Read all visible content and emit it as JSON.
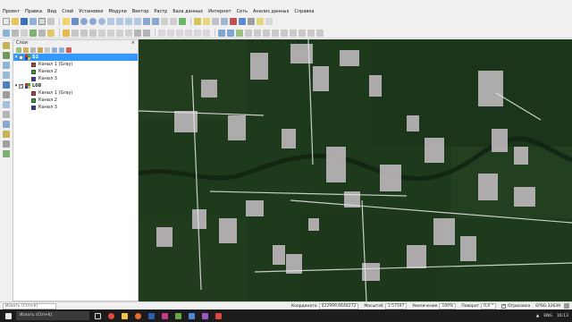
{
  "menu": [
    "Проект",
    "Правка",
    "Вид",
    "Слой",
    "Установки",
    "Модули",
    "Вектор",
    "Растр",
    "База данных",
    "Интернет",
    "Сеть",
    "Анализ данных",
    "Справка"
  ],
  "panel": {
    "title": "Слои",
    "close_symbol": "×",
    "layers": [
      {
        "name": "S2",
        "checked": false,
        "selected": true,
        "bands": [
          {
            "label": "Канал 1 (Gray)",
            "color": "#c83232"
          },
          {
            "label": "Канал 2",
            "color": "#2eaa2e"
          },
          {
            "label": "Канал 3",
            "color": "#2e3ab4"
          }
        ]
      },
      {
        "name": "L08",
        "checked": true,
        "selected": false,
        "bands": [
          {
            "label": "Канал 1 (Gray)",
            "color": "#c83232"
          },
          {
            "label": "Канал 2",
            "color": "#2eaa2e"
          },
          {
            "label": "Канал 3",
            "color": "#2e3ab4"
          }
        ]
      }
    ]
  },
  "status": {
    "search_placeholder": "Искать (Ctrl+K)",
    "coord_label": "Координата",
    "coord_value": "422999,6648272",
    "scale_label": "Масштаб",
    "scale_value": "1:57597",
    "magnifier_label": "Увеличение",
    "magnifier_value": "100%",
    "rotation_label": "Поворот",
    "rotation_value": "0,0 °",
    "render_label": "Отрисовка",
    "crs_value": "EPSG:32639"
  },
  "taskbar": {
    "search_text": "Искать (Ctrl+K)",
    "language": "ENG",
    "time": "16:13"
  },
  "colors": {
    "selection": "#3399ff",
    "map_base": "#1e3a1c",
    "clearing": "#c8bfc6"
  }
}
